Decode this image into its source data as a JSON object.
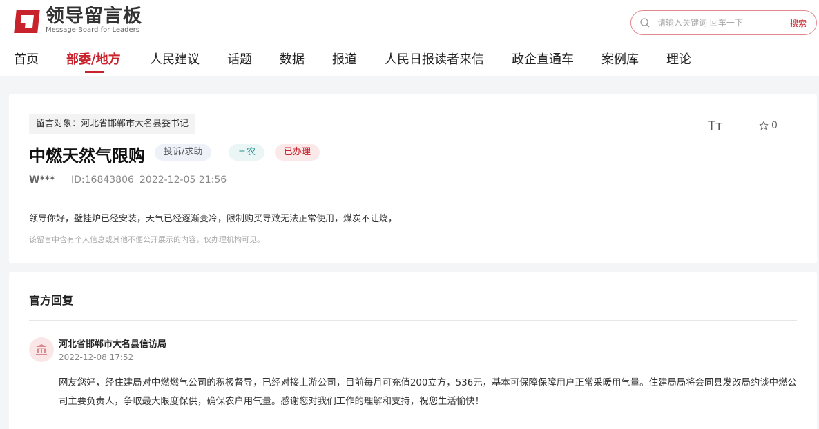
{
  "header": {
    "logo_title": "领导留言板",
    "logo_subtitle": "Message Board for Leaders",
    "search": {
      "placeholder": "请输入关键词 回车一下",
      "button": "搜索"
    }
  },
  "nav": {
    "items": [
      "首页",
      "部委/地方",
      "人民建议",
      "话题",
      "数据",
      "报道",
      "人民日报读者来信",
      "政企直通车",
      "案例库",
      "理论"
    ],
    "active_index": 1
  },
  "message": {
    "target": "留言对象：河北省邯郸市大名县委书记",
    "title": "中燃天然气限购",
    "tags": {
      "type": "投诉/求助",
      "category": "三农",
      "status": "已办理"
    },
    "font_toggle": "Tт",
    "favorites": "0",
    "author": "W***",
    "id": "ID:16843806",
    "date": "2022-12-05 21:56",
    "body": "领导你好，壁挂炉已经安装，天气已经逐渐变冷，限制购买导致无法正常使用，煤炭不让烧，",
    "privacy_note": "该留言中含有个人信息或其他不便公开展示的内容，仅办理机构可见。"
  },
  "reply": {
    "heading": "官方回复",
    "org_name": "河北省邯郸市大名县信访局",
    "date": "2022-12-08 17:52",
    "body": "网友您好，经住建局对中燃燃气公司的积极督导，已经对接上游公司，目前每月可充值200立方，536元，基本可保障保障用户正常采暖用气量。住建局局将会同县发改局约谈中燃公司主要负责人，争取最大限度保供，确保农户用气量。感谢您对我们工作的理解和支持，祝您生活愉快！"
  },
  "colors": {
    "brand": "#c8232c",
    "page_bg": "#f4f5f7"
  }
}
